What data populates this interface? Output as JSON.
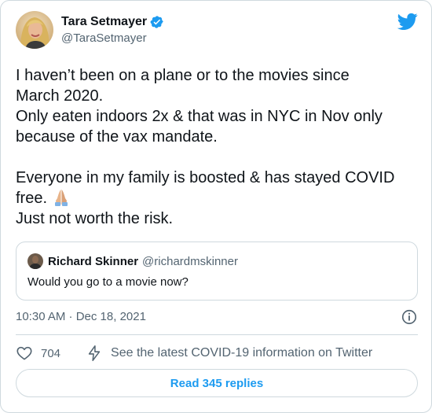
{
  "tweet": {
    "author": {
      "display_name": "Tara Setmayer",
      "handle": "@TaraSetmayer",
      "verified": true
    },
    "text_lines": [
      "I haven’t been on a plane or to the movies since",
      "March 2020.",
      "Only eaten indoors 2x & that was in NYC in Nov only",
      "because of the vax mandate.",
      "",
      "Everyone in my family is boosted & has stayed COVID",
      "free.",
      "Just not worth the risk."
    ],
    "emoji": "folded-hands-emoji",
    "timestamp": "10:30 AM · Dec 18, 2021",
    "like_count": "704",
    "covid_info_label": "See the latest COVID-19 information on Twitter",
    "replies_button_label": "Read 345 replies"
  },
  "quoted_tweet": {
    "display_name": "Richard Skinner",
    "handle": "@richardmskinner",
    "text": "Would you go to a movie now?"
  },
  "icons": {
    "logo": "twitter-bird-icon",
    "verified": "verified-badge-icon",
    "info": "info-icon",
    "like": "heart-icon",
    "covid": "lightning-bolt-icon"
  },
  "colors": {
    "accent": "#1d9bf0",
    "text_primary": "#0f1419",
    "text_secondary": "#536471",
    "border": "#cfd9de"
  }
}
